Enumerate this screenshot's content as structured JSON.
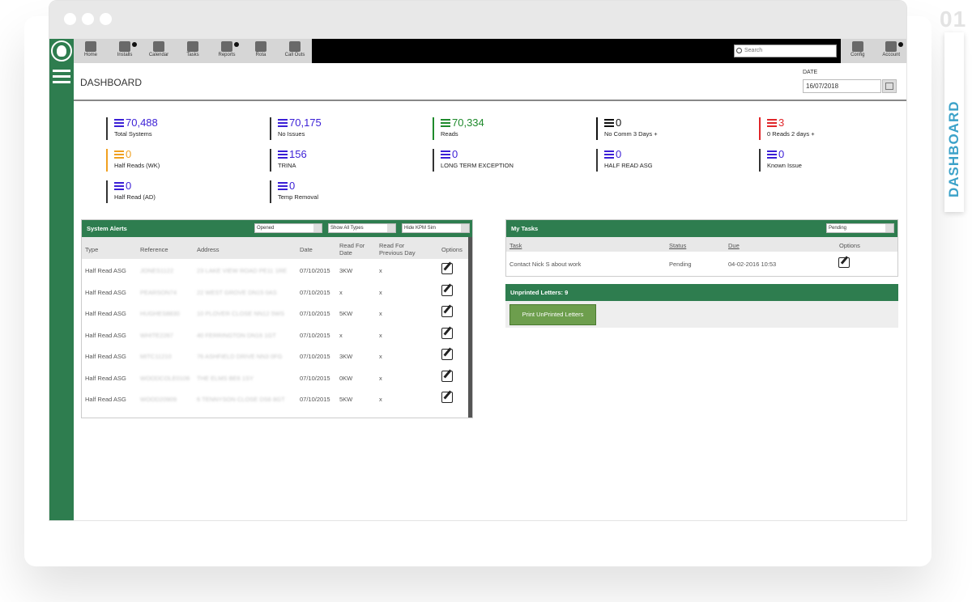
{
  "mockup": {
    "page_number": "01",
    "side_label": "DASHBOARD"
  },
  "nav": {
    "items": [
      {
        "label": "Home",
        "icon": "home-icon"
      },
      {
        "label": "Installs",
        "icon": "gear-icon"
      },
      {
        "label": "Calendar",
        "icon": "calendar-icon"
      },
      {
        "label": "Tasks",
        "icon": "tasks-icon"
      },
      {
        "label": "Reports",
        "icon": "chart-icon"
      },
      {
        "label": "Rota",
        "icon": "clipboard-icon"
      },
      {
        "label": "Call Outs",
        "icon": "truck-icon"
      }
    ],
    "search_placeholder": "Search",
    "right_items": [
      {
        "label": "Config",
        "icon": "gears-icon"
      },
      {
        "label": "Account",
        "icon": "user-icon"
      }
    ]
  },
  "header": {
    "title": "DASHBOARD",
    "date_label": "DATE",
    "date_value": "16/07/2018"
  },
  "stats": [
    {
      "value": "70,488",
      "label": "Total Systems",
      "color": "#3b1fd6",
      "bar": "#333333"
    },
    {
      "value": "70,175",
      "label": "No Issues",
      "color": "#3b1fd6",
      "bar": "#333333"
    },
    {
      "value": "70,334",
      "label": "Reads",
      "color": "#1f8a2c",
      "bar": "#1f8a2c"
    },
    {
      "value": "0",
      "label": "No Comm 3 Days +",
      "color": "#111111",
      "bar": "#111111"
    },
    {
      "value": "3",
      "label": "0 Reads 2 days +",
      "color": "#e0262a",
      "bar": "#e0262a"
    },
    {
      "value": "0",
      "label": "Half Reads (WK)",
      "color": "#f0a020",
      "bar": "#f0a020"
    },
    {
      "value": "156",
      "label": "TRINA",
      "color": "#3b1fd6",
      "bar": "#333333"
    },
    {
      "value": "0",
      "label": "LONG TERM EXCEPTION",
      "color": "#3b1fd6",
      "bar": "#333333"
    },
    {
      "value": "0",
      "label": "HALF READ ASG",
      "color": "#3b1fd6",
      "bar": "#333333"
    },
    {
      "value": "0",
      "label": "Known Issue",
      "color": "#3b1fd6",
      "bar": "#333333"
    },
    {
      "value": "0",
      "label": "Half Read (AD)",
      "color": "#3b1fd6",
      "bar": "#333333"
    },
    {
      "value": "0",
      "label": "Temp Removal",
      "color": "#3b1fd6",
      "bar": "#333333"
    }
  ],
  "alerts": {
    "title": "System Alerts",
    "filters": [
      "Opened",
      "Show All Types",
      "Hide KPM Sim"
    ],
    "columns": [
      "Type",
      "Reference",
      "Address",
      "Date",
      "Read For Date",
      "Read For Previous Day",
      "Options"
    ],
    "rows": [
      {
        "type": "Half Read ASG",
        "ref": "JONES1122",
        "addr": "23 LAKE VIEW ROAD PE11 1RE",
        "date": "07/10/2015",
        "read": "3KW",
        "prev": "x"
      },
      {
        "type": "Half Read ASG",
        "ref": "PEARSON74",
        "addr": "22 WEST GROVE DN15 0AS",
        "date": "07/10/2015",
        "read": "x",
        "prev": "x"
      },
      {
        "type": "Half Read ASG",
        "ref": "HUGHES8830",
        "addr": "10 PLOVER CLOSE NN12 5WS",
        "date": "07/10/2015",
        "read": "5KW",
        "prev": "x"
      },
      {
        "type": "Half Read ASG",
        "ref": "WHITE2267",
        "addr": "40 FERRINGTON DN16 1GT",
        "date": "07/10/2015",
        "read": "x",
        "prev": "x"
      },
      {
        "type": "Half Read ASG",
        "ref": "MITC11210",
        "addr": "76 ASHFIELD DRIVE NN3 0FG",
        "date": "07/10/2015",
        "read": "3KW",
        "prev": "x"
      },
      {
        "type": "Half Read ASG",
        "ref": "WOODCOLE0106",
        "addr": "THE ELMS BE6 1SY",
        "date": "07/10/2015",
        "read": "0KW",
        "prev": "x"
      },
      {
        "type": "Half Read ASG",
        "ref": "WOOD20909",
        "addr": "6 TENNYSON CLOSE DS6 8GT",
        "date": "07/10/2015",
        "read": "5KW",
        "prev": "x"
      }
    ]
  },
  "tasks": {
    "title": "My Tasks",
    "filter": "Pending",
    "columns": [
      "Task",
      "Status",
      "Due",
      "Options"
    ],
    "rows": [
      {
        "task": "Contact Nick S about work",
        "status": "Pending",
        "due": "04-02-2016 10:53"
      }
    ]
  },
  "letters": {
    "title": "Unprinted Letters: 9",
    "button": "Print UnPrinted Letters"
  }
}
